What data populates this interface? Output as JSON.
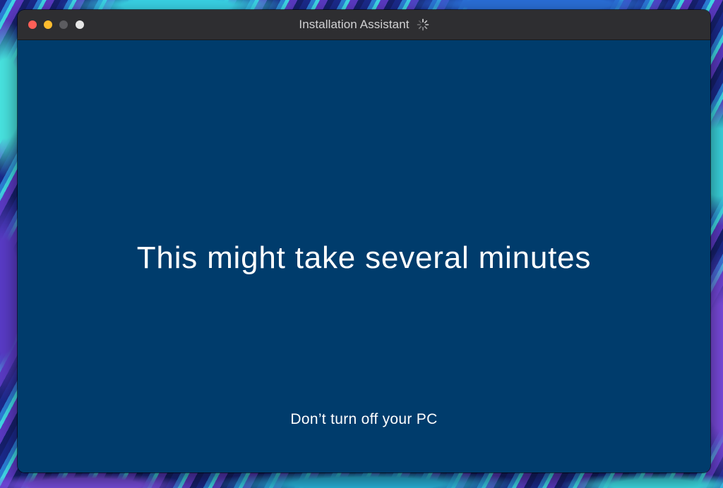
{
  "window": {
    "title": "Installation Assistant",
    "title_icon": "loading-spinner-icon",
    "controls": [
      "close-icon",
      "minimize-icon",
      "zoom-icon",
      "extra-icon"
    ],
    "colors": {
      "close": "#fe5f57",
      "minimize": "#febc2e",
      "zoom": "#5c5c60",
      "extra": "#e6e6e6",
      "titlebar": "#2e2e31",
      "content_background": "#003c6c"
    }
  },
  "screen": {
    "headline": "This might take several minutes",
    "subline": "Don’t turn off your PC"
  }
}
